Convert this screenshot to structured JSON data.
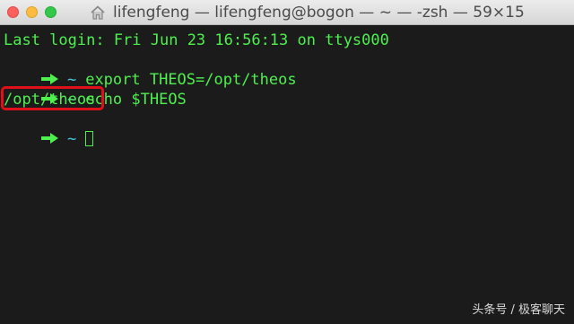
{
  "window": {
    "title": "lifengfeng — lifengfeng@bogon — ~ — -zsh — 59×15",
    "title_icon": "home-icon"
  },
  "terminal": {
    "colors": {
      "text": "#4ef04e",
      "tilde": "#44c8d8",
      "background": "#1b1b1b",
      "highlight": "#e0101a"
    },
    "last_login": "Last login: Fri Jun 23 16:56:13 on ttys000",
    "prompt_symbol": "~",
    "command1": "export THEOS=/opt/theos",
    "command2": "echo $THEOS",
    "output": "/opt/theos"
  },
  "watermark": "头条号 / 极客聊天"
}
